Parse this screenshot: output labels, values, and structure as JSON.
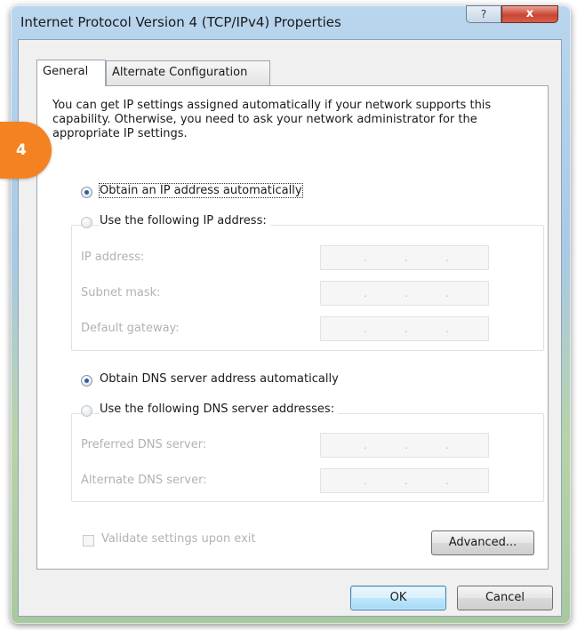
{
  "window": {
    "title": "Internet Protocol Version 4 (TCP/IPv4) Properties",
    "help_label": "?",
    "close_label": "x"
  },
  "badge": "4",
  "tabs": [
    {
      "label": "General"
    },
    {
      "label": "Alternate Configuration"
    }
  ],
  "intro": "You can get IP settings assigned automatically if your network supports this capability. Otherwise, you need to ask your network administrator for the appropriate IP settings.",
  "ip": {
    "auto_label": "Obtain an IP address automatically",
    "manual_label": "Use the following IP address:",
    "fields": [
      {
        "label": "IP address:",
        "value": ". . ."
      },
      {
        "label": "Subnet mask:",
        "value": ". . ."
      },
      {
        "label": "Default gateway:",
        "value": ". . ."
      }
    ]
  },
  "dns": {
    "auto_label": "Obtain DNS server address automatically",
    "manual_label": "Use the following DNS server addresses:",
    "fields": [
      {
        "label": "Preferred DNS server:",
        "value": ". . ."
      },
      {
        "label": "Alternate DNS server:",
        "value": ". . ."
      }
    ]
  },
  "validate_label": "Validate settings upon exit",
  "buttons": {
    "advanced": "Advanced...",
    "ok": "OK",
    "cancel": "Cancel"
  },
  "colors": {
    "badge": "#f58220",
    "selected_radio": "#2a5fa8",
    "disabled_text": "#b2b2b2"
  }
}
